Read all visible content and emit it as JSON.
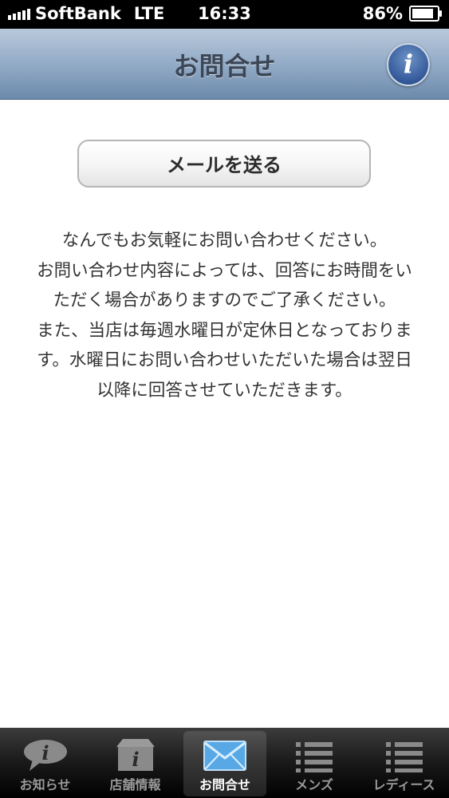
{
  "status_bar": {
    "carrier": "SoftBank",
    "network": "LTE",
    "time": "16:33",
    "battery_percent": "86%",
    "battery_level": 0.86
  },
  "nav": {
    "title": "お問合せ",
    "info_icon": "i"
  },
  "mail_button": {
    "label": "メールを送る"
  },
  "message_lines": [
    "なんでもお気軽にお問い合わせください。",
    "お問い合わせ内容によっては、回答にお時間をい",
    "ただく場合がありますのでご了承ください。",
    "また、当店は毎週水曜日が定休日となっておりま",
    "す。水曜日にお問い合わせいただいた場合は翌日",
    "以降に回答させていただきます。"
  ],
  "tabs": [
    {
      "label": "お知らせ",
      "icon": "info-bubble-icon",
      "active": false
    },
    {
      "label": "店舗情報",
      "icon": "store-info-icon",
      "active": false
    },
    {
      "label": "お問合せ",
      "icon": "mail-icon",
      "active": true
    },
    {
      "label": "メンズ",
      "icon": "list-icon",
      "active": false
    },
    {
      "label": "レディース",
      "icon": "list-icon",
      "active": false
    }
  ],
  "colors": {
    "nav_gradient_top": "#b9c9dc",
    "nav_gradient_bottom": "#6d8aac",
    "info_button": "#33599a",
    "tab_active_icon": "#5aa9e8"
  }
}
